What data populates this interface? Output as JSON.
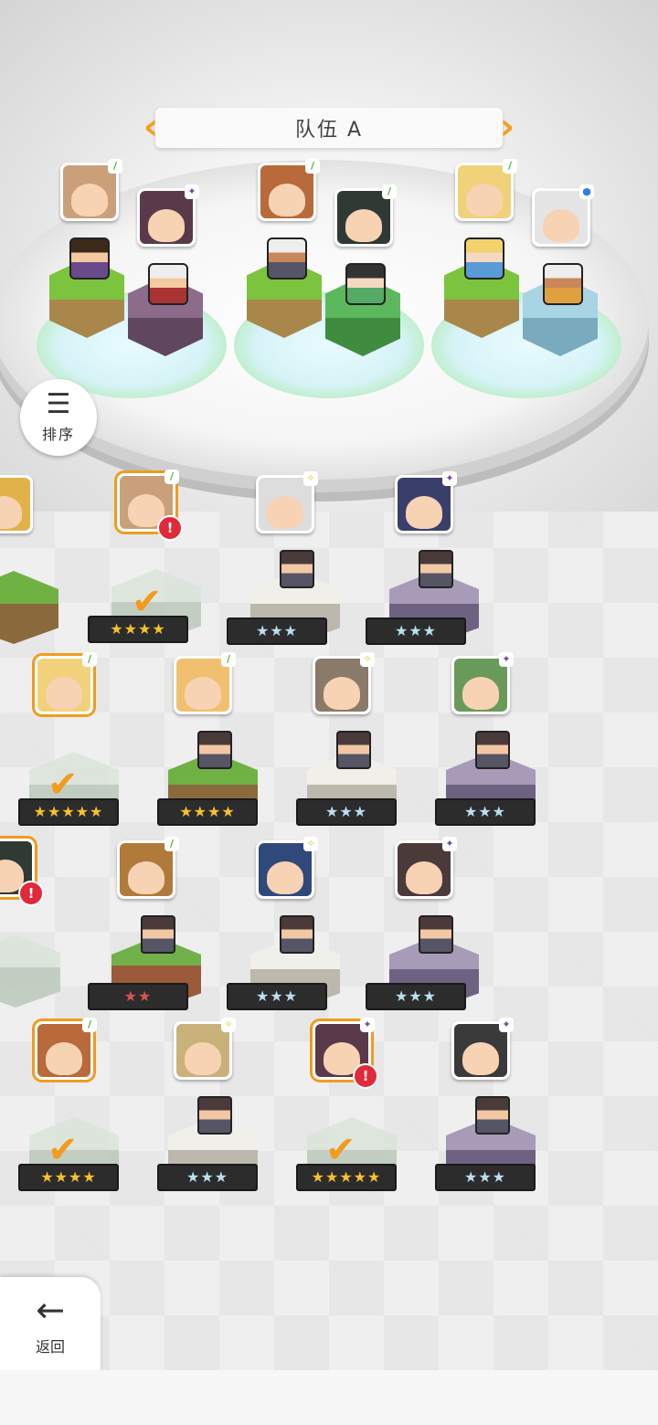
{
  "team": {
    "title": "队伍 A",
    "prev_icon": "chevron-left-icon",
    "next_icon": "chevron-right-icon"
  },
  "sort": {
    "label": "排序",
    "icon": "sort-icon"
  },
  "back": {
    "label": "返回",
    "icon": "back-arrow-icon"
  },
  "colors": {
    "accent": "#f29b1d",
    "alert": "#e02a3a",
    "nature": "#3dbb2d"
  },
  "slots": [
    {
      "element_a": "nature",
      "element_b": "dark"
    },
    {
      "element_a": "nature",
      "element_b": "nature"
    },
    {
      "element_a": "nature",
      "element_b": "water"
    }
  ],
  "roster": [
    {
      "stars": "★★★★",
      "selected": true,
      "alert": "!",
      "element": "nature"
    },
    {
      "stars": "★★★",
      "selected": false,
      "element": "light"
    },
    {
      "stars": "★★★",
      "selected": false,
      "element": "dark"
    },
    {
      "stars": "★★★★★",
      "selected": true,
      "element": "nature"
    },
    {
      "stars": "★★★★",
      "selected": false,
      "element": "nature"
    },
    {
      "stars": "★★★",
      "selected": false,
      "element": "light"
    },
    {
      "stars": "★★★",
      "selected": false,
      "element": "dark"
    },
    {
      "stars": "★★",
      "selected": false,
      "element": "nature"
    },
    {
      "stars": "★★★",
      "selected": false,
      "element": "light"
    },
    {
      "stars": "★★★",
      "selected": false,
      "element": "dark"
    },
    {
      "stars": "★★★★",
      "selected": true,
      "element": "nature"
    },
    {
      "stars": "★★★",
      "selected": false,
      "element": "light"
    },
    {
      "stars": "★★★★★",
      "selected": true,
      "alert": "!",
      "element": "dark"
    },
    {
      "stars": "★★★",
      "selected": false,
      "element": "dark"
    }
  ]
}
